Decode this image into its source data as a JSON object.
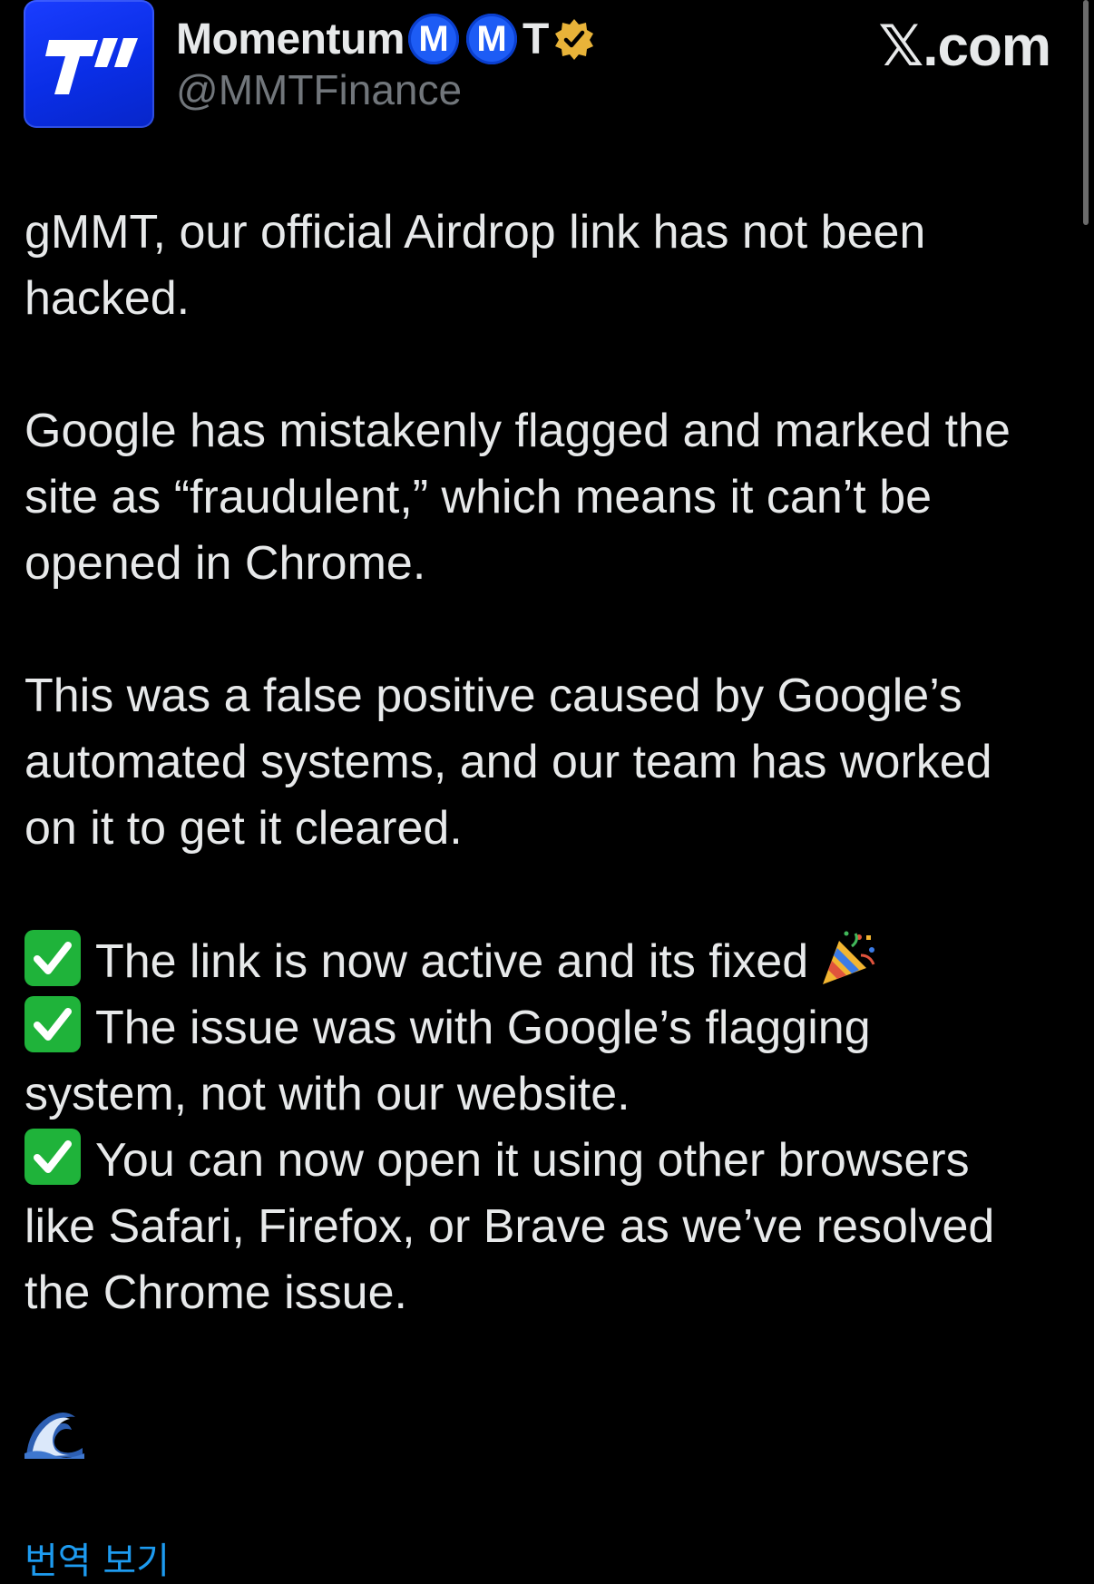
{
  "author": {
    "display_name": "Momentum",
    "badge_letter_1": "M",
    "badge_letter_2": "M",
    "badge_letter_3": "T",
    "handle": "@MMTFinance",
    "verified": true,
    "avatar_color": "#1a3dff"
  },
  "site_brand": "𝕏.com",
  "tweet": {
    "paragraph_1_line_1": "gMMT, our official Airdrop link has not been",
    "paragraph_1_line_2": "hacked.",
    "paragraph_2_line_1": "Google has mistakenly flagged and marked the",
    "paragraph_2_line_2": "site as “fraudulent,” which means it can’t be",
    "paragraph_2_line_3": "opened in Chrome.",
    "paragraph_3_line_1": "This was a false positive caused by Google’s",
    "paragraph_3_line_2": "automated systems, and our team has worked",
    "paragraph_3_line_3": "on it to get it cleared.",
    "check_1": "The link is now active and its fixed",
    "check_2_line_1": "The issue was with Google’s flagging",
    "check_2_line_2": "system, not with our website.",
    "check_3_line_1": "You can now open it using other browsers",
    "check_3_line_2": "like Safari, Firefox, or Brave as we’ve resolved",
    "check_3_line_3": "the Chrome issue."
  },
  "translate_link": "번역 보기",
  "icons": {
    "check": "check-mark-button-icon",
    "party": "party-popper-icon",
    "wave": "water-wave-icon",
    "verified": "gold-verified-badge-icon"
  },
  "colors": {
    "background": "#000000",
    "text": "#e7e9ea",
    "muted": "#71767b",
    "link": "#1d9bf0",
    "verified_gold": "#e8b339",
    "check_green": "#1fb33a"
  }
}
